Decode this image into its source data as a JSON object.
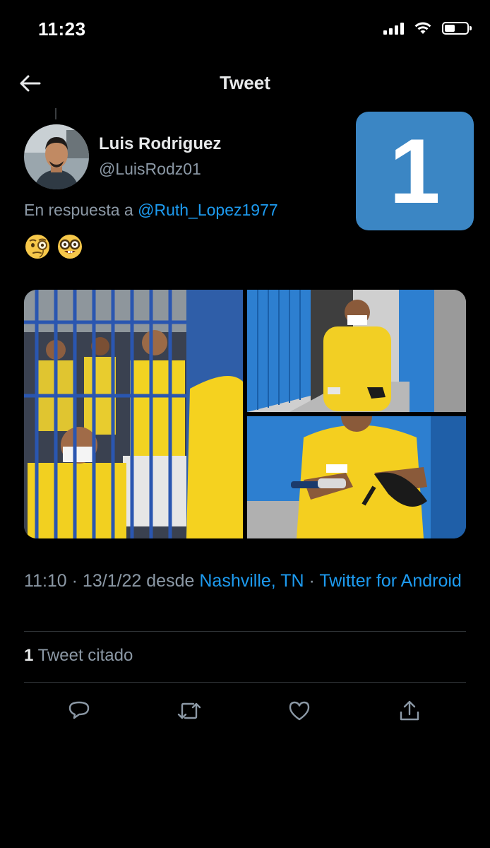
{
  "status_bar": {
    "time": "11:23",
    "icons": [
      "cellular-signal-icon",
      "wifi-icon",
      "battery-icon"
    ]
  },
  "header": {
    "title": "Tweet",
    "back_icon": "arrow-left-icon"
  },
  "tweet": {
    "author_name": "Luis Rodriguez",
    "author_handle": "@LuisRodz01",
    "reply_prefix": "En respuesta a",
    "reply_to": "@Ruth_Lopez1977",
    "emojis": [
      "face-with-monocle",
      "nerd-face"
    ],
    "overlay_number": "1",
    "timestamp": "11:10 · 13/1/22 desde",
    "location": "Nashville, TN",
    "source_prefix": "·",
    "source": "Twitter for Android",
    "quote_count": "1",
    "quote_label": "Tweet citado"
  },
  "actions": [
    "reply-icon",
    "retweet-icon",
    "like-icon",
    "share-icon"
  ],
  "colors": {
    "background": "#000000",
    "accent": "#1d9bf0",
    "secondary_text": "#8b98a5",
    "badge": "#3b86c4"
  }
}
